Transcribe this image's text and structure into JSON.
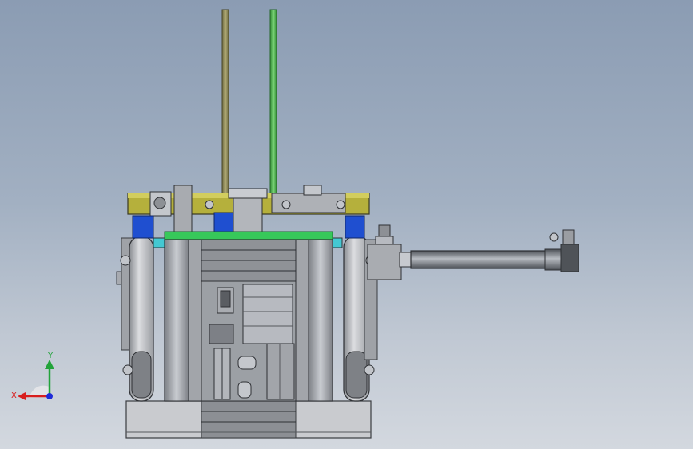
{
  "view": {
    "background_top": "#8b9cb3",
    "background_bottom": "#d3d8df"
  },
  "triad": {
    "x_label": "X",
    "y_label": "Y",
    "x_color": "#d81e1e",
    "y_color": "#22a33a",
    "z_color": "#1e2bd8"
  },
  "model": {
    "colors": {
      "rod_olive": "#8e8a5a",
      "rod_green": "#5cb85a",
      "yellow_plate": "#b5b03c",
      "blue_block": "#1f4fd0",
      "green_plate": "#37c85a",
      "steel": "#b9bcc2",
      "dark_steel": "#6b6e73",
      "cyan_spacer": "#44c8d2"
    }
  }
}
